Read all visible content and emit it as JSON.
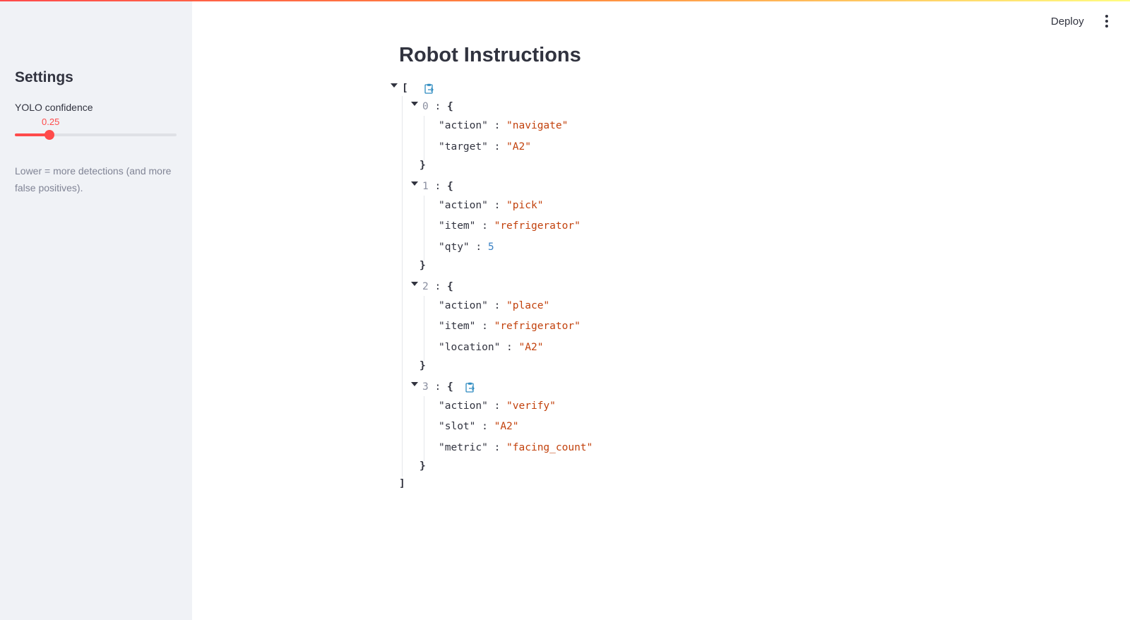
{
  "sidebar": {
    "title": "Settings",
    "slider": {
      "label": "YOLO confidence",
      "value": "0.25",
      "fraction": 0.25,
      "accent": "#ff4b4b"
    },
    "caption": "Lower = more detections (and more false positives)."
  },
  "header": {
    "deploy_label": "Deploy",
    "menu_icon": "kebab-menu-icon"
  },
  "main": {
    "title": "Robot Instructions",
    "json": {
      "open_bracket": "[",
      "close_bracket": "]",
      "open_brace": "{",
      "close_brace": "}",
      "colon": ":",
      "items": [
        {
          "index": "0",
          "fields": [
            {
              "key": "\"action\"",
              "value": "\"navigate\"",
              "type": "string"
            },
            {
              "key": "\"target\"",
              "value": "\"A2\"",
              "type": "string"
            }
          ]
        },
        {
          "index": "1",
          "fields": [
            {
              "key": "\"action\"",
              "value": "\"pick\"",
              "type": "string"
            },
            {
              "key": "\"item\"",
              "value": "\"refrigerator\"",
              "type": "string"
            },
            {
              "key": "\"qty\"",
              "value": "5",
              "type": "number"
            }
          ]
        },
        {
          "index": "2",
          "fields": [
            {
              "key": "\"action\"",
              "value": "\"place\"",
              "type": "string"
            },
            {
              "key": "\"item\"",
              "value": "\"refrigerator\"",
              "type": "string"
            },
            {
              "key": "\"location\"",
              "value": "\"A2\"",
              "type": "string"
            }
          ]
        },
        {
          "index": "3",
          "fields": [
            {
              "key": "\"action\"",
              "value": "\"verify\"",
              "type": "string"
            },
            {
              "key": "\"slot\"",
              "value": "\"A2\"",
              "type": "string"
            },
            {
              "key": "\"metric\"",
              "value": "\"facing_count\"",
              "type": "string"
            }
          ]
        }
      ]
    }
  },
  "colors": {
    "accent": "#ff4b4b",
    "string": "#c2410c",
    "number": "#3b82c4",
    "sidebar_bg": "#f0f2f6"
  }
}
